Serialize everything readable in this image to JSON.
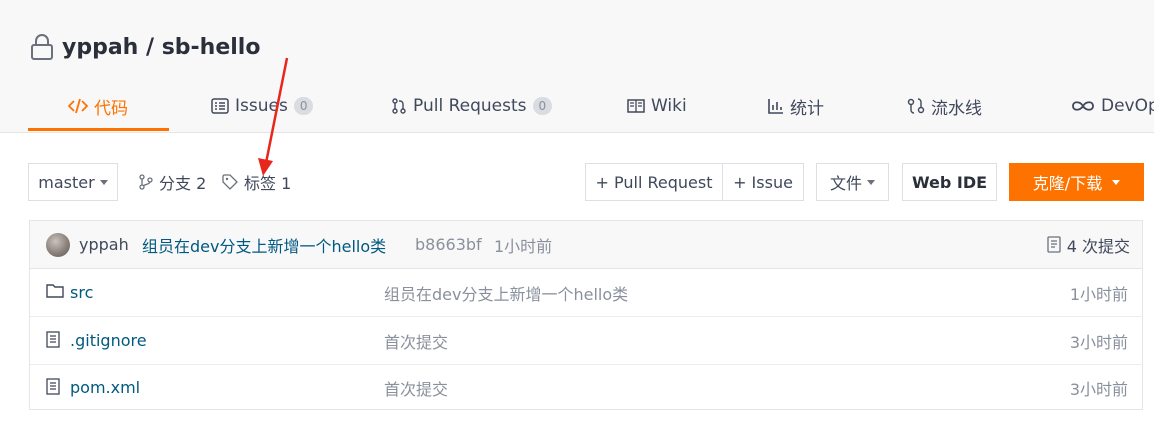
{
  "repo": {
    "title": "yppah / sb-hello"
  },
  "tabs": [
    {
      "label": "代码",
      "icon": "code-icon",
      "active": true
    },
    {
      "label": "Issues",
      "badge": "0",
      "icon": "issues-icon"
    },
    {
      "label": "Pull Requests",
      "badge": "0",
      "icon": "pull-request-icon"
    },
    {
      "label": "Wiki",
      "icon": "wiki-book-icon"
    },
    {
      "label": "统计",
      "icon": "stats-icon"
    },
    {
      "label": "流水线",
      "icon": "pipeline-icon"
    },
    {
      "label": "DevOps",
      "icon": "infinity-icon"
    }
  ],
  "toolbar": {
    "branch_select": "master",
    "branches": "分支 2",
    "tags": "标签 1",
    "new_pr": "+ Pull Request",
    "new_issue": "+ Issue",
    "file_menu": "文件",
    "web_ide": "Web IDE",
    "clone": "克隆/下载"
  },
  "commit": {
    "author": "yppah",
    "message": "组员在dev分支上新增一个hello类",
    "hash": "b8663bf",
    "time": "1小时前",
    "count": "4 次提交"
  },
  "files": [
    {
      "name": "src",
      "type": "folder",
      "message": "组员在dev分支上新增一个hello类",
      "time": "1小时前"
    },
    {
      "name": ".gitignore",
      "type": "file",
      "message": "首次提交",
      "time": "3小时前"
    },
    {
      "name": "pom.xml",
      "type": "file",
      "message": "首次提交",
      "time": "3小时前"
    }
  ],
  "colors": {
    "accent": "#fe7300",
    "link": "#005980",
    "annotation_arrow": "#e8261c"
  }
}
